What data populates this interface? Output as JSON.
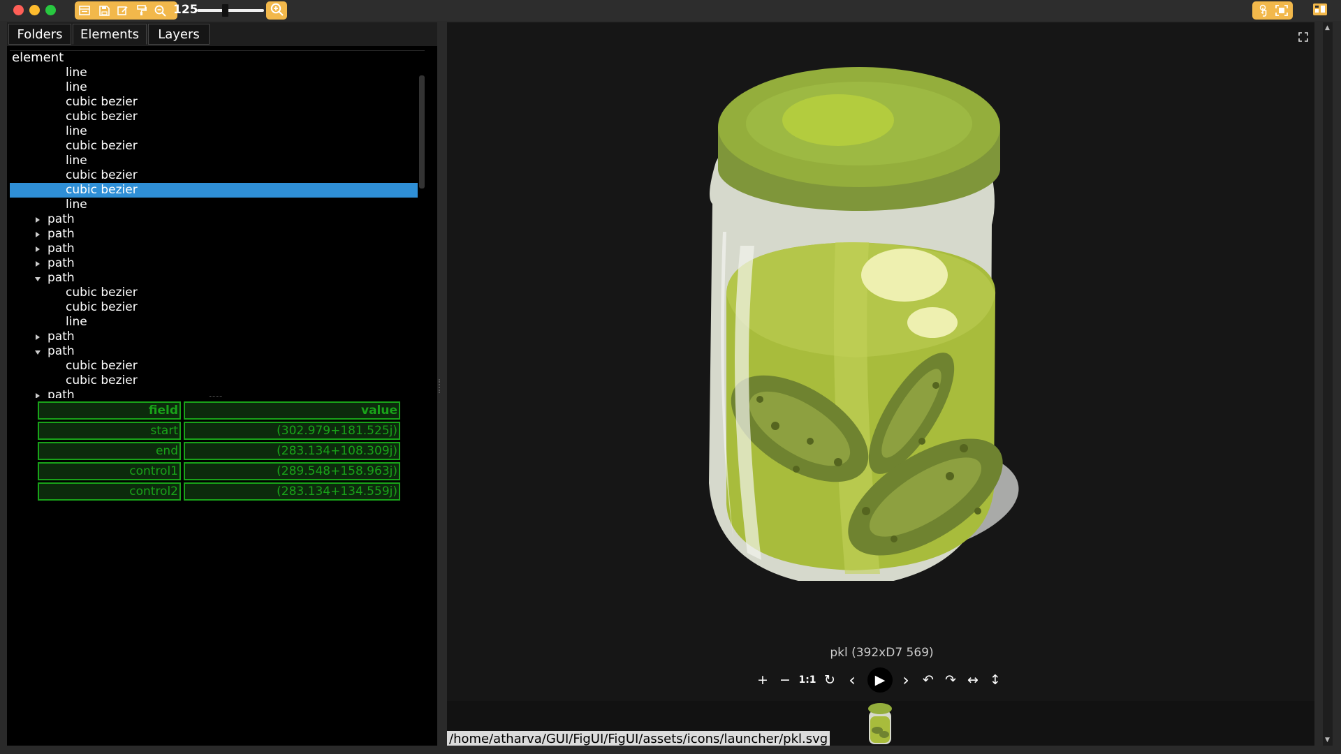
{
  "app": {
    "zoom_value": "125"
  },
  "tabs": [
    {
      "label": "Folders"
    },
    {
      "label": "Elements"
    },
    {
      "label": "Layers"
    }
  ],
  "tree": {
    "header": "element",
    "rows": [
      {
        "label": "line",
        "level": 2
      },
      {
        "label": "line",
        "level": 2
      },
      {
        "label": "cubic bezier",
        "level": 2
      },
      {
        "label": "cubic bezier",
        "level": 2
      },
      {
        "label": "line",
        "level": 2
      },
      {
        "label": "cubic bezier",
        "level": 2
      },
      {
        "label": "line",
        "level": 2
      },
      {
        "label": "cubic bezier",
        "level": 2
      },
      {
        "label": "cubic bezier",
        "level": 2,
        "selected": true
      },
      {
        "label": "line",
        "level": 2
      },
      {
        "label": "path",
        "level": 1,
        "expanded": false
      },
      {
        "label": "path",
        "level": 1,
        "expanded": false
      },
      {
        "label": "path",
        "level": 1,
        "expanded": false
      },
      {
        "label": "path",
        "level": 1,
        "expanded": false
      },
      {
        "label": "path",
        "level": 1,
        "expanded": true
      },
      {
        "label": "cubic bezier",
        "level": 2
      },
      {
        "label": "cubic bezier",
        "level": 2
      },
      {
        "label": "line",
        "level": 2
      },
      {
        "label": "path",
        "level": 1,
        "expanded": false
      },
      {
        "label": "path",
        "level": 1,
        "expanded": true
      },
      {
        "label": "cubic bezier",
        "level": 2
      },
      {
        "label": "cubic bezier",
        "level": 2
      },
      {
        "label": "path",
        "level": 1,
        "expanded": false
      }
    ]
  },
  "properties": {
    "headers": {
      "field": "field",
      "value": "value"
    },
    "rows": [
      {
        "field": "start",
        "value": "(302.979+181.525j)"
      },
      {
        "field": "end",
        "value": "(283.134+108.309j)"
      },
      {
        "field": "control1",
        "value": "(289.548+158.963j)"
      },
      {
        "field": "control2",
        "value": "(283.134+134.559j)"
      }
    ]
  },
  "viewer": {
    "caption": "pkl (392xD7 569)",
    "controls": [
      "+",
      "−",
      "1:1",
      "↻",
      "‹",
      "▶",
      "›",
      "↶",
      "↷",
      "↔",
      "↕"
    ],
    "file_path": "/home/atharva/GUI/FigUI/FigUI/assets/icons/launcher/pkl.svg"
  },
  "icons": {
    "toolbar": [
      "menu-icon",
      "save-icon",
      "edit-icon",
      "format-paint-icon",
      "zoom-out-icon"
    ],
    "zoom_in": "zoom-in-icon",
    "right_tools": [
      "touch-icon",
      "fit-screen-icon"
    ],
    "far_right": "archive-icon",
    "fullscreen": "fullscreen-icon"
  },
  "colors": {
    "accent": "#f2b84b",
    "selection": "#2f8fd6",
    "table_green": "#19a319",
    "jar_lid": "#8fae3a",
    "jar_liquid": "#a8bc3c"
  }
}
